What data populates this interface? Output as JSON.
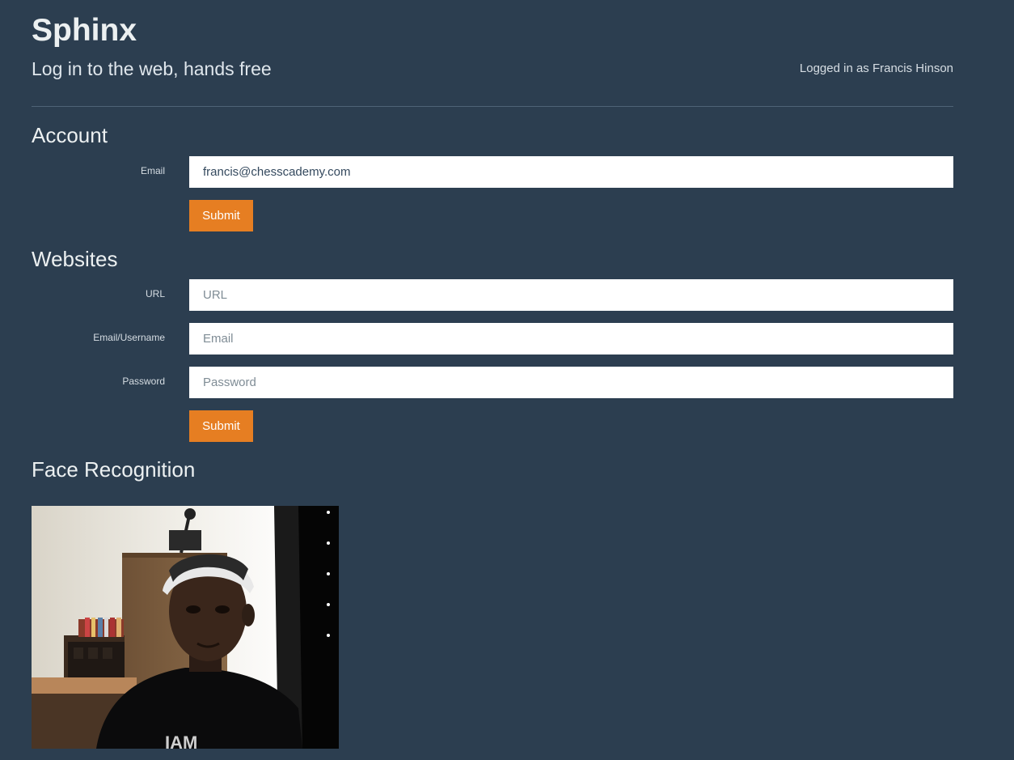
{
  "header": {
    "brand": "Sphinx",
    "tagline": "Log in to the web, hands free",
    "logged_in": "Logged in as Francis Hinson"
  },
  "account": {
    "title": "Account",
    "email_label": "Email",
    "email_value": "francis@chesscademy.com",
    "submit_label": "Submit"
  },
  "websites": {
    "title": "Websites",
    "url_label": "URL",
    "url_placeholder": "URL",
    "username_label": "Email/Username",
    "username_placeholder": "Email",
    "password_label": "Password",
    "password_placeholder": "Password",
    "submit_label": "Submit"
  },
  "face": {
    "title": "Face Recognition",
    "camera_feed_text": "IAM"
  },
  "colors": {
    "background": "#2c3e50",
    "accent": "#e67e22",
    "text": "#ecf0f1"
  }
}
